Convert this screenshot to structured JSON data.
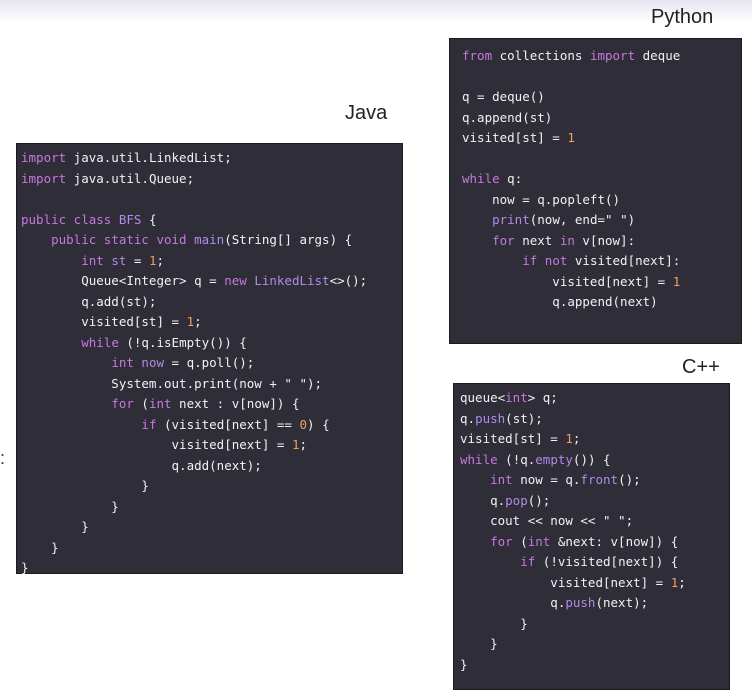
{
  "labels": {
    "python": "Python",
    "java": "Java",
    "cpp": "C++",
    "edge_colon": ":"
  },
  "panels": {
    "java": {
      "lines": [
        [
          {
            "t": "import",
            "c": "kw"
          },
          {
            "t": " java.util.LinkedList;"
          }
        ],
        [
          {
            "t": "import",
            "c": "kw"
          },
          {
            "t": " java.util.Queue;"
          }
        ],
        [],
        [
          {
            "t": "public class",
            "c": "kw"
          },
          {
            "t": " "
          },
          {
            "t": "BFS",
            "c": "fn"
          },
          {
            "t": " {"
          }
        ],
        [
          {
            "t": "    "
          },
          {
            "t": "public static void",
            "c": "kw"
          },
          {
            "t": " "
          },
          {
            "t": "main",
            "c": "fn"
          },
          {
            "t": "(String[] args) {"
          }
        ],
        [
          {
            "t": "        "
          },
          {
            "t": "int",
            "c": "kw"
          },
          {
            "t": " "
          },
          {
            "t": "st",
            "c": "fn"
          },
          {
            "t": " = "
          },
          {
            "t": "1",
            "c": "num"
          },
          {
            "t": ";"
          }
        ],
        [
          {
            "t": "        Queue<Integer> q = "
          },
          {
            "t": "new",
            "c": "kw"
          },
          {
            "t": " "
          },
          {
            "t": "LinkedList",
            "c": "fn"
          },
          {
            "t": "<>();"
          }
        ],
        [
          {
            "t": "        q.add(st);"
          }
        ],
        [
          {
            "t": "        visited[st] = "
          },
          {
            "t": "1",
            "c": "num"
          },
          {
            "t": ";"
          }
        ],
        [
          {
            "t": "        "
          },
          {
            "t": "while",
            "c": "kw"
          },
          {
            "t": " (!q.isEmpty()) {"
          }
        ],
        [
          {
            "t": "            "
          },
          {
            "t": "int",
            "c": "kw"
          },
          {
            "t": " "
          },
          {
            "t": "now",
            "c": "fn"
          },
          {
            "t": " = q.poll();"
          }
        ],
        [
          {
            "t": "            System.out.print(now + "
          },
          {
            "t": "\" \"",
            "c": "str"
          },
          {
            "t": ");"
          }
        ],
        [
          {
            "t": "            "
          },
          {
            "t": "for",
            "c": "kw"
          },
          {
            "t": " ("
          },
          {
            "t": "int",
            "c": "kw"
          },
          {
            "t": " next : v[now]) {"
          }
        ],
        [
          {
            "t": "                "
          },
          {
            "t": "if",
            "c": "kw"
          },
          {
            "t": " (visited[next] == "
          },
          {
            "t": "0",
            "c": "num"
          },
          {
            "t": ") {"
          }
        ],
        [
          {
            "t": "                    visited[next] = "
          },
          {
            "t": "1",
            "c": "num"
          },
          {
            "t": ";"
          }
        ],
        [
          {
            "t": "                    q.add(next);"
          }
        ],
        [
          {
            "t": "                }"
          }
        ],
        [
          {
            "t": "            }"
          }
        ],
        [
          {
            "t": "        }"
          }
        ],
        [
          {
            "t": "    }"
          }
        ],
        [
          {
            "t": "}"
          }
        ]
      ]
    },
    "python": {
      "lines": [
        [
          {
            "t": "from",
            "c": "kw"
          },
          {
            "t": " collections "
          },
          {
            "t": "import",
            "c": "kw"
          },
          {
            "t": " deque"
          }
        ],
        [],
        [
          {
            "t": "q = deque()"
          }
        ],
        [
          {
            "t": "q.append(st)"
          }
        ],
        [
          {
            "t": "visited[st] = "
          },
          {
            "t": "1",
            "c": "num"
          }
        ],
        [],
        [
          {
            "t": "while",
            "c": "kw"
          },
          {
            "t": " q:"
          }
        ],
        [
          {
            "t": "    now = q.popleft()"
          }
        ],
        [
          {
            "t": "    "
          },
          {
            "t": "print",
            "c": "fn"
          },
          {
            "t": "(now, end="
          },
          {
            "t": "\" \"",
            "c": "str"
          },
          {
            "t": ")"
          }
        ],
        [
          {
            "t": "    "
          },
          {
            "t": "for",
            "c": "kw"
          },
          {
            "t": " next "
          },
          {
            "t": "in",
            "c": "kw"
          },
          {
            "t": " v[now]:"
          }
        ],
        [
          {
            "t": "        "
          },
          {
            "t": "if not",
            "c": "kw"
          },
          {
            "t": " visited[next]:"
          }
        ],
        [
          {
            "t": "            visited[next] = "
          },
          {
            "t": "1",
            "c": "num"
          }
        ],
        [
          {
            "t": "            q.append(next)"
          }
        ]
      ]
    },
    "cpp": {
      "lines": [
        [
          {
            "t": "queue<"
          },
          {
            "t": "int",
            "c": "kw"
          },
          {
            "t": "> q;"
          }
        ],
        [
          {
            "t": "q."
          },
          {
            "t": "push",
            "c": "fn"
          },
          {
            "t": "(st);"
          }
        ],
        [
          {
            "t": "visited[st] = "
          },
          {
            "t": "1",
            "c": "num"
          },
          {
            "t": ";"
          }
        ],
        [
          {
            "t": "while",
            "c": "kw"
          },
          {
            "t": " (!q."
          },
          {
            "t": "empty",
            "c": "fn"
          },
          {
            "t": "()) {"
          }
        ],
        [
          {
            "t": "    "
          },
          {
            "t": "int",
            "c": "kw"
          },
          {
            "t": " now = q."
          },
          {
            "t": "front",
            "c": "fn"
          },
          {
            "t": "();"
          }
        ],
        [
          {
            "t": "    q."
          },
          {
            "t": "pop",
            "c": "fn"
          },
          {
            "t": "();"
          }
        ],
        [
          {
            "t": "    cout << now << "
          },
          {
            "t": "\" \"",
            "c": "str"
          },
          {
            "t": ";"
          }
        ],
        [
          {
            "t": "    "
          },
          {
            "t": "for",
            "c": "kw"
          },
          {
            "t": " ("
          },
          {
            "t": "int",
            "c": "kw"
          },
          {
            "t": " &next: v[now]) {"
          }
        ],
        [
          {
            "t": "        "
          },
          {
            "t": "if",
            "c": "kw"
          },
          {
            "t": " (!visited[next]) {"
          }
        ],
        [
          {
            "t": "            visited[next] = "
          },
          {
            "t": "1",
            "c": "num"
          },
          {
            "t": ";"
          }
        ],
        [
          {
            "t": "            q."
          },
          {
            "t": "push",
            "c": "fn"
          },
          {
            "t": "(next);"
          }
        ],
        [
          {
            "t": "        }"
          }
        ],
        [
          {
            "t": "    }"
          }
        ],
        [
          {
            "t": "}"
          }
        ]
      ]
    }
  },
  "colors": {
    "panel_bg": "#2e2d38",
    "text": "#f2f2f2",
    "keyword": "#c678dd",
    "identifier": "#b18be6",
    "number": "#f0a060"
  }
}
